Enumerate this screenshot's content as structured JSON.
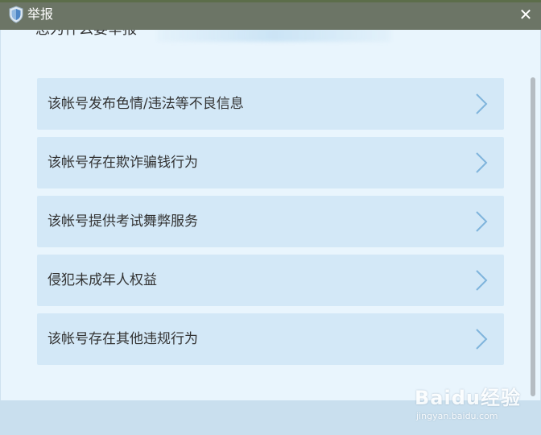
{
  "window": {
    "title": "举报",
    "close_glyph": "✕",
    "subheading": "您为什么要举报"
  },
  "icons": {
    "title_icon": "shield-icon",
    "close_icon": "close-icon",
    "item_icon": "chevron-right-icon"
  },
  "colors": {
    "titlebar": "#6c7566",
    "item_bg": "#d3e8f7",
    "chevron": "#7fb4dc",
    "panel_bg": "#e9f5fd"
  },
  "reasons": [
    {
      "label": "该帐号发布色情/违法等不良信息"
    },
    {
      "label": "该帐号存在欺诈骗钱行为"
    },
    {
      "label": "该帐号提供考试舞弊服务"
    },
    {
      "label": "侵犯未成年人权益"
    },
    {
      "label": "该帐号存在其他违规行为"
    }
  ],
  "watermark": {
    "brand": "Baidu经验",
    "site": "jingyan.baidu.com"
  }
}
